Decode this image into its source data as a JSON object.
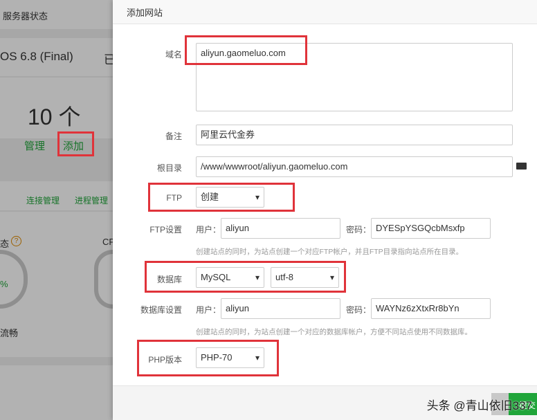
{
  "background": {
    "tab": "服务器状态",
    "os": "OS 6.8 (Final)",
    "os_suffix": "已",
    "site_count": "10 个",
    "manage": "管理",
    "add": "添加",
    "links": [
      "连接管理",
      "进程管理"
    ],
    "status_label": "态",
    "cpu_label": "CP",
    "percent": "%",
    "fluency": "流畅"
  },
  "modal": {
    "title": "添加网站",
    "domain_label": "域名",
    "domain_value": "aliyun.gaomeluo.com",
    "note_label": "备注",
    "note_value": "阿里云代金券",
    "root_label": "根目录",
    "root_value": "/www/wwwroot/aliyun.gaomeluo.com",
    "ftp_label": "FTP",
    "ftp_value": "创建",
    "ftp_settings_label": "FTP设置",
    "user_label": "用户：",
    "pass_label": "密码：",
    "ftp_user": "aliyun",
    "ftp_pass": "DYESpYSGQcbMsxfp",
    "ftp_hint": "创建站点的同时，为站点创建一个对应FTP帐户，并且FTP目录指向站点所在目录。",
    "db_label": "数据库",
    "db_type": "MySQL",
    "db_charset": "utf-8",
    "db_settings_label": "数据库设置",
    "db_user": "aliyun",
    "db_pass": "WAYNz6zXtxRr8bYn",
    "db_hint": "创建站点的同时，为站点创建一个对应的数据库帐户，方便不同站点使用不同数据库。",
    "php_label": "PHP版本",
    "php_value": "PHP-70",
    "submit": "提交"
  },
  "watermark": "头条 @青山依旧337",
  "colors": {
    "accent": "#20a53a",
    "highlight": "#e0333a"
  }
}
